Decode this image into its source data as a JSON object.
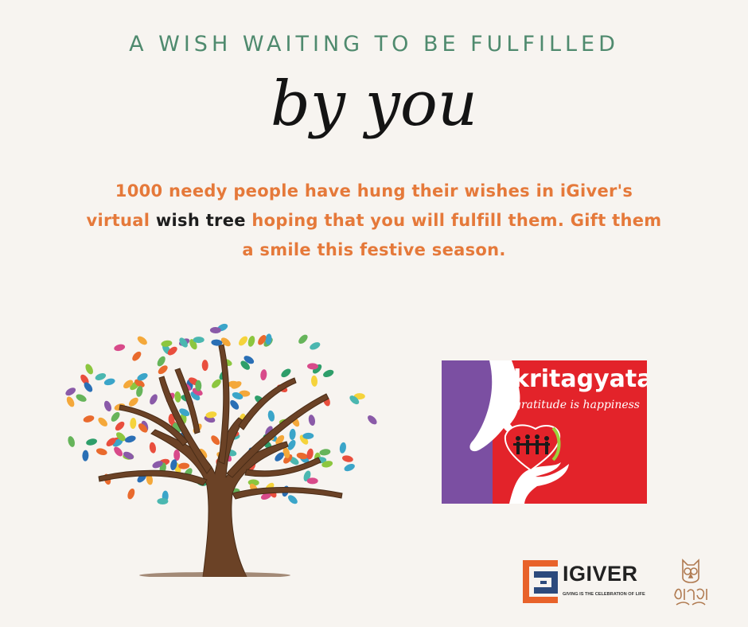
{
  "headline": "A WISH WAITING TO BE FULFILLED",
  "script_text": "by you",
  "message": {
    "part1": "1000 needy people have hung their wishes in iGiver's",
    "part2a": "virtual",
    "part2_highlight": "wish tree",
    "part2b": "hoping that you will fulfill them. Gift them",
    "part3": "a smile this festive season."
  },
  "kritagyata": {
    "title": "kritagyata",
    "tagline": "gratitude is happiness"
  },
  "igiver": {
    "name": "IGIVER",
    "tagline": "GIVING IS THE CELEBRATION OF LIFE"
  },
  "colors": {
    "background": "#f7f4f0",
    "headline": "#4f8a6e",
    "message": "#e5793a",
    "kritagyata_red": "#e3232a",
    "kritagyata_purple": "#7b4fa2",
    "igiver_orange": "#e8622a",
    "igiver_blue": "#2c4a7c"
  },
  "icons": [
    "wish-tree-illustration",
    "kritagyata-logo",
    "igiver-logo",
    "owl-logo"
  ]
}
